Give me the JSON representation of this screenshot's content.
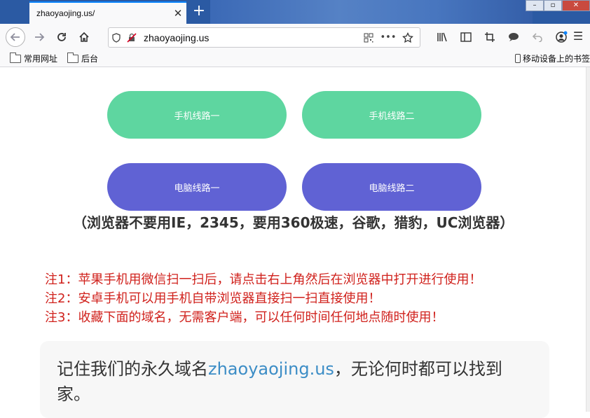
{
  "browser": {
    "tab_title": "zhaoyaojing.us/",
    "tab_close": "✕",
    "new_tab": "+",
    "url": "zhaoyaojing.us"
  },
  "bookmarks": {
    "items": [
      "常用网址",
      "后台"
    ],
    "mobile": "移动设备上的书签"
  },
  "buttons": {
    "mobile_1": "手机线路一",
    "mobile_2": "手机线路二",
    "pc_1": "电脑线路一",
    "pc_2": "电脑线路二"
  },
  "browser_note": "（浏览器不要用IE，2345，要用360极速，谷歌，猎豹，UC浏览器）",
  "notes": [
    "注1：苹果手机用微信扫一扫后，请点击右上角然后在浏览器中打开进行使用！",
    "注2：安卓手机可以用手机自带浏览器直接扫一扫直接使用！",
    "注3：收藏下面的域名，无需客户端，可以任何时间任何地点随时使用！"
  ],
  "remember": {
    "prefix": "记住我们的永久域名",
    "domain": "zhaoyaojing.us",
    "suffix": "，无论何时都可以找到家。"
  },
  "colors": {
    "green_button": "#5ed6a0",
    "purple_button": "#6062d4",
    "note_red": "#d0211c",
    "domain_blue": "#3c8dc6"
  }
}
